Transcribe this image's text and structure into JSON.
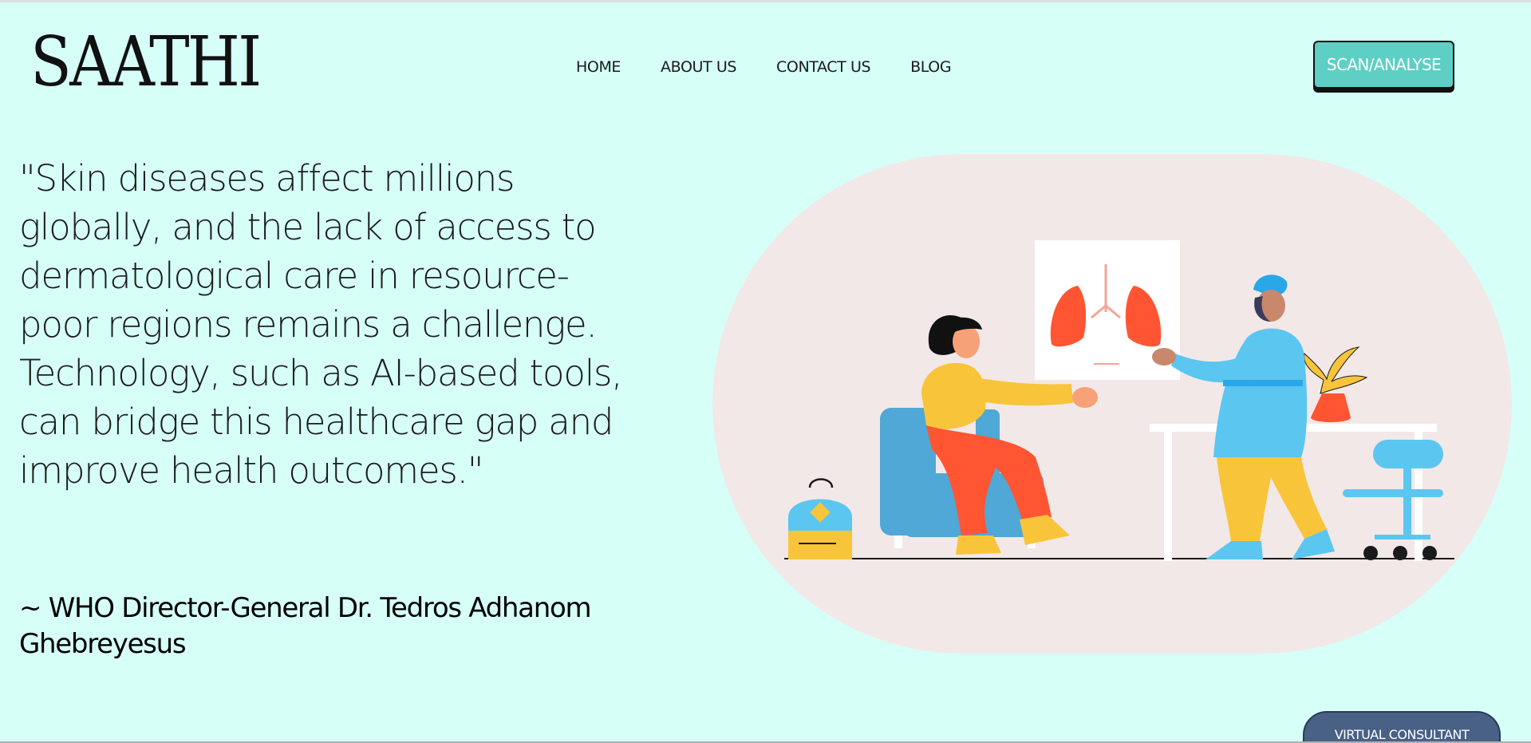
{
  "header": {
    "logo": "SAATHI",
    "nav": {
      "home": "HOME",
      "about": "ABOUT US",
      "contact": "CONTACT US",
      "blog": "BLOG"
    },
    "cta_label": "SCAN/ANALYSE"
  },
  "hero": {
    "quote": "\"Skin diseases affect millions globally, and the lack of access to dermatological care in resource-poor regions remains a challenge. Technology, such as AI-based tools, can bridge this healthcare gap and improve health outcomes.\"",
    "attribution": "~ WHO Director-General Dr. Tedros Adhanom Ghebreyesus"
  },
  "floating": {
    "virtual_consultant_label": "VIRTUAL CONSULTANT"
  },
  "colors": {
    "background": "#d6fff8",
    "accent": "#5ecfc4",
    "consultant_button": "#4a6186",
    "illustration_blob": "#f2e8e8"
  },
  "icons": {
    "illustration": "doctor-patient-lungs-illustration"
  }
}
